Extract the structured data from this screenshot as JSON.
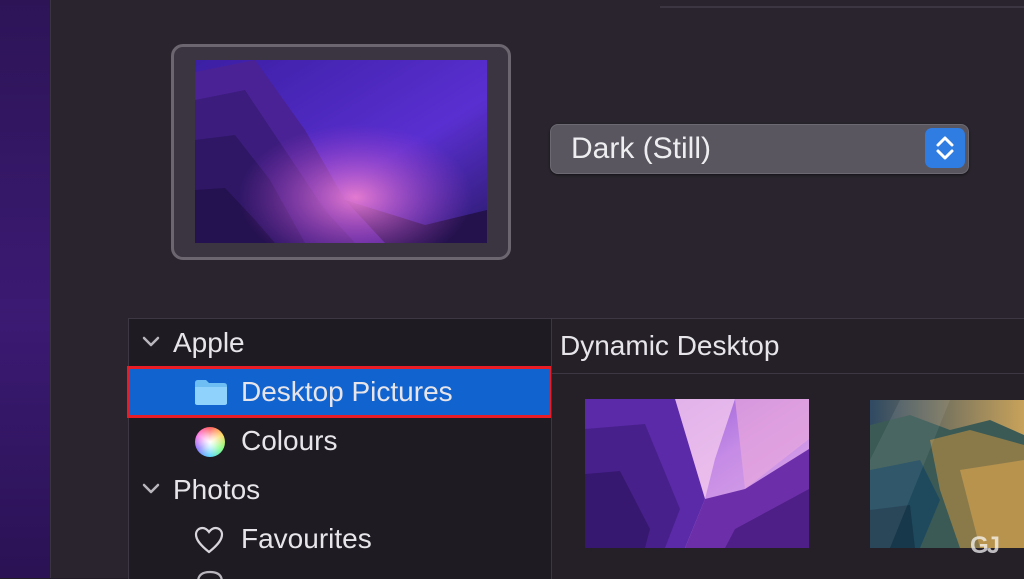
{
  "appearance": {
    "selected_value": "Dark (Still)"
  },
  "sidebar": {
    "groups": [
      {
        "label": "Apple",
        "items": [
          {
            "label": "Desktop Pictures",
            "icon": "folder-icon",
            "selected": true
          },
          {
            "label": "Colours",
            "icon": "colour-wheel-icon",
            "selected": false
          }
        ]
      },
      {
        "label": "Photos",
        "items": [
          {
            "label": "Favourites",
            "icon": "heart-icon",
            "selected": false
          }
        ]
      }
    ]
  },
  "content": {
    "section_title": "Dynamic Desktop",
    "thumbnails": [
      {
        "name": "monterey-wallpaper"
      },
      {
        "name": "big-sur-coast-wallpaper"
      }
    ]
  },
  "colors": {
    "selection": "#1163cf",
    "highlight_border": "#e81c24",
    "stepper": "#2f7de2"
  },
  "watermark": {
    "text": "GJ"
  }
}
